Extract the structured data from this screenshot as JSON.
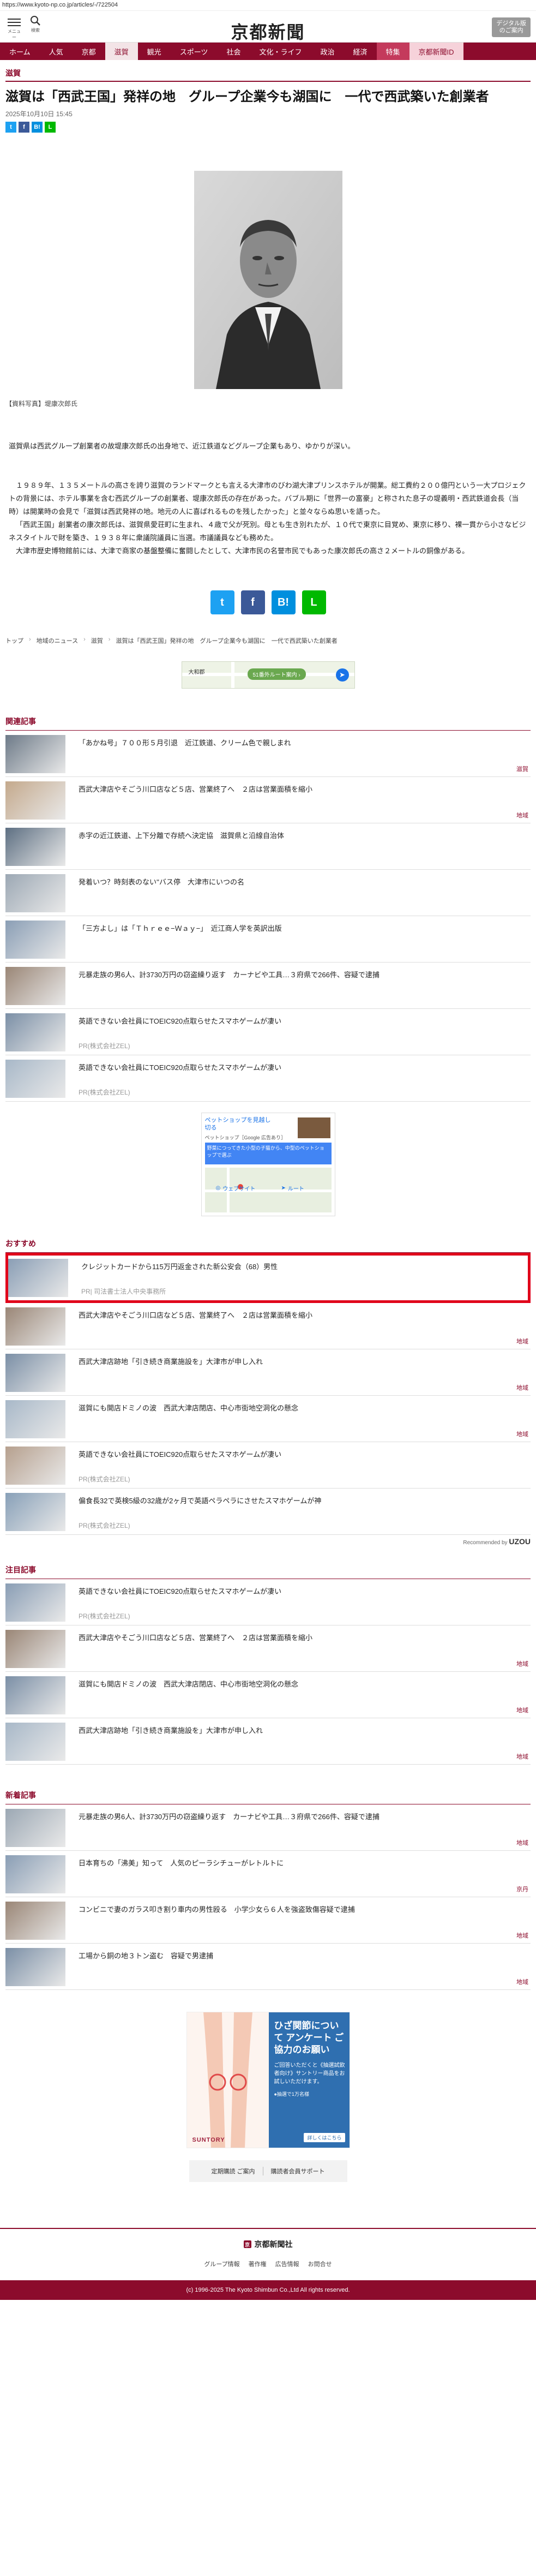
{
  "url": "https://www.kyoto-np.co.jp/articles/-/722504",
  "header": {
    "menu_label": "メニュー",
    "search_label": "検索",
    "logo": "京都新聞",
    "digital_btn": "デジタル版\nのご案内"
  },
  "nav": [
    "ホーム",
    "人気",
    "京都",
    "滋賀",
    "観光",
    "スポーツ",
    "社会",
    "文化・ライフ",
    "政治",
    "経済",
    "特集",
    "京都新聞ID"
  ],
  "article": {
    "category": "滋賀",
    "title": "滋賀は「西武王国」発祥の地　グループ企業今も湖国に　一代で西武築いた創業者",
    "date": "2025年10月10日 15:45",
    "caption": "【資料写真】堤康次郎氏",
    "lead": "滋賀県は西武グループ創業者の故堤康次郎氏の出身地で、近江鉄道などグループ企業もあり、ゆかりが深い。",
    "paragraphs": [
      "１９８９年、１３５メートルの高さを誇り滋賀のランドマークとも言える大津市のびわ湖大津プリンスホテルが開業。総工費約２００億円という一大プロジェクトの背景には、ホテル事業を含む西武グループの創業者、堤康次郎氏の存在があった。バブル期に「世界一の富豪」と称された息子の堤義明・西武鉄道会長（当時）は開業時の会見で「滋賀は西武発祥の地。地元の人に喜ばれるものを残したかった」と並々ならぬ思いを語った。",
      "「西武王国」創業者の康次郎氏は、滋賀県愛荘町に生まれ、４歳で父が死別。母とも生き別れたが、１０代で東京に目覚め、東京に移り、裸一貫から小さなビジネスタイトルで財を築き、１９３８年に衆議院議員に当選。市議議員なども務めた。",
      "大津市歴史博物館前には、大津で商家の基盤整備に奮闘したとして、大津市民の名誉市民でもあった康次郎氏の高さ２メートルの銅像がある。"
    ],
    "share": [
      "t",
      "f",
      "B!",
      "L"
    ]
  },
  "breadcrumb": [
    "トップ",
    "地域のニュース",
    "滋賀",
    "滋賀は「西武王国」発祥の地　グループ企業今も湖国に　一代で西武築いた創業者"
  ],
  "map_banner": {
    "shop": "大和郡",
    "pill": "51番外ルート案内 ›",
    "direction_icon": "directions-icon"
  },
  "related": {
    "heading": "関連記事",
    "items": [
      {
        "title": "「あかね号」７００形５月引退　近江鉄道、クリーム色で親しまれ",
        "cat": "滋賀"
      },
      {
        "title": "西武大津店やそごう川口店など５店、営業終了へ　２店は営業面積を縮小",
        "cat": "地域"
      },
      {
        "title": "赤字の近江鉄道、上下分離で存続へ決定協　滋賀県と沿線自治体",
        "cat": ""
      },
      {
        "title": "発着いつ？時刻表のない''バス停　大津市にいつの名",
        "cat": ""
      },
      {
        "title": "「三方よし」は「Ｔｈｒｅｅ−Ｗａｙ−」　近江商人学を英訳出版",
        "cat": ""
      },
      {
        "title": "元暴走族の男6人、計3730万円の窃盗繰り返す　カーナビや工具…３府県で266件、容疑で逮捕",
        "cat": ""
      },
      {
        "title": "英語できない会社員にTOEIC920点取らせたスマホゲームが凄い",
        "pr": "PR(株式会社ZEL)",
        "cat": ""
      },
      {
        "title": "英語できない会社員にTOEIC920点取らせたスマホゲームが凄い",
        "pr": "PR(株式会社ZEL)",
        "cat": ""
      }
    ]
  },
  "inline_ad": {
    "title": "ペットショップを見越し 切る",
    "sub": "ペットショップ［Google 広告あり］",
    "blue_text": "野菜につってきた小型の子猫から、中型のペットショップで選ぶ",
    "website": "ウェブサイト",
    "route": "ルート"
  },
  "recommend": {
    "heading": "おすすめ",
    "items": [
      {
        "title": "クレジットカードから115万円返金された新公安会（68）男性",
        "pr": "PR| 司法書士法人中央事務所",
        "highlight": true,
        "cat": ""
      },
      {
        "title": "西武大津店やそごう川口店など５店、営業終了へ　２店は営業面積を縮小",
        "cat": "地域"
      },
      {
        "title": "西武大津店跡地「引き続き商業施設を」大津市が申し入れ",
        "cat": "地域"
      },
      {
        "title": "滋賀にも開店ドミノの波　西武大津店閉店、中心市街地空洞化の懸念",
        "cat": "地域"
      },
      {
        "title": "英語できない会社員にTOEIC920点取らせたスマホゲームが凄い",
        "pr": "PR(株式会社ZEL)",
        "cat": ""
      },
      {
        "title": "偏食長32で英検5級の32歳が2ヶ月で英語ペラペラにさせたスマホゲームが神",
        "pr": "PR(株式会社ZEL)",
        "cat": ""
      }
    ],
    "recommended_by": "Recommended by",
    "brand": "UZOU"
  },
  "attention": {
    "heading": "注目記事",
    "items": [
      {
        "title": "英語できない会社員にTOEIC920点取らせたスマホゲームが凄い",
        "pr": "PR(株式会社ZEL)",
        "cat": ""
      },
      {
        "title": "西武大津店やそごう川口店など５店、営業終了へ　２店は営業面積を縮小",
        "cat": "地域"
      },
      {
        "title": "滋賀にも開店ドミノの波　西武大津店閉店、中心市街地空洞化の懸念",
        "cat": "地域"
      },
      {
        "title": "西武大津店跡地「引き続き商業施設を」大津市が申し入れ",
        "cat": "地域"
      }
    ]
  },
  "newest": {
    "heading": "新着記事",
    "items": [
      {
        "title": "元暴走族の男6人、計3730万円の窃盗繰り返す　カーナビや工具…３府県で266件、容疑で逮捕",
        "cat": "地域"
      },
      {
        "title": "日本育ちの「沸美」知って　人気のピーラシチューがレトルトに",
        "cat": "京丹"
      },
      {
        "title": "コンビニで妻のガラス叩き割り車内の男性殴る　小学少女ら６人を強盗致傷容疑で逮捕",
        "cat": "地域"
      },
      {
        "title": "工場から銅の地３トン盗む　容疑で男逮捕",
        "cat": "地域"
      }
    ]
  },
  "legs_ad": {
    "headline": "ひざ関節について アンケート ご協力のお願い",
    "sub": "ご回答いただくと《抽選試飲者向け》サントリー商品をお試しいただけます。",
    "note": "●抽選で1万名様",
    "btn": "詳しくはこちら",
    "brand": "SUNTORY"
  },
  "bottom_links": [
    "定期購読 ご案内",
    "購読者会員サポート"
  ],
  "footer": {
    "logo": "京都新聞社",
    "links": [
      "グループ情報",
      "著作権",
      "広告情報",
      "お問合せ"
    ],
    "copyright": "(c) 1996-2025 The Kyoto Shimbun Co.,Ltd All rights reserved."
  },
  "colors": {
    "brand": "#8c0b2c",
    "twitter": "#1da1f2",
    "facebook": "#3b5998",
    "hatena": "#008fde",
    "line": "#00b900",
    "highlight": "#e0001a"
  }
}
